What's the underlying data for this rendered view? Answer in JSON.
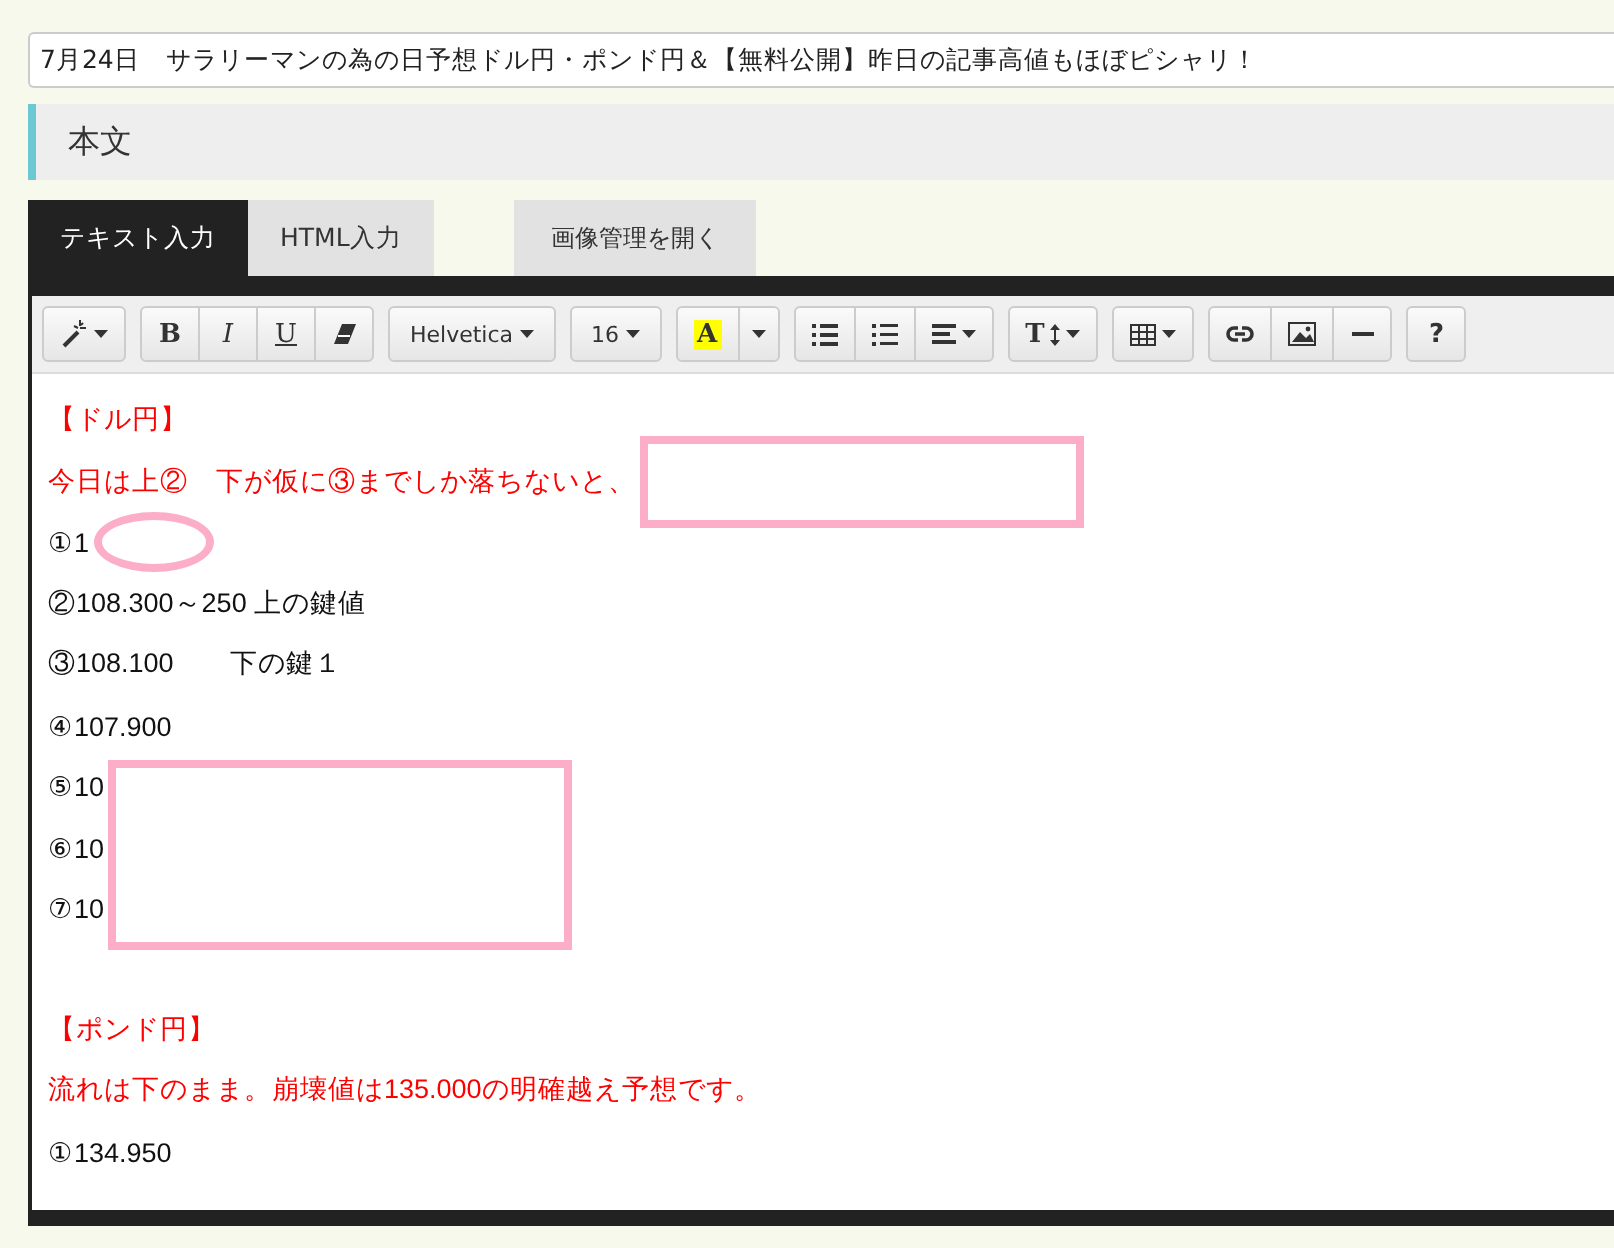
{
  "title_field": {
    "value": "7月24日　サラリーマンの為の日予想ドル円・ポンド円＆【無料公開】昨日の記事高値もほぼピシャリ！"
  },
  "section": {
    "title": "本文"
  },
  "tabs": [
    {
      "label": "テキスト入力",
      "selected": true
    },
    {
      "label": "HTML入力",
      "selected": false
    }
  ],
  "image_button": {
    "label": "画像管理を開く"
  },
  "toolbar": [
    [
      {
        "kind": "magic"
      }
    ],
    [
      {
        "kind": "bold",
        "label": "B"
      },
      {
        "kind": "italic",
        "label": "I"
      },
      {
        "kind": "underline",
        "label": "U"
      },
      {
        "kind": "eraser"
      }
    ],
    [
      {
        "kind": "dropdown",
        "label": "Helvetica"
      }
    ],
    [
      {
        "kind": "dropdown",
        "label": "16"
      }
    ],
    [
      {
        "kind": "color",
        "label": "A"
      },
      {
        "kind": "caret"
      }
    ],
    [
      {
        "kind": "ul"
      },
      {
        "kind": "ol"
      },
      {
        "kind": "align"
      }
    ],
    [
      {
        "kind": "textsize",
        "label": "T"
      }
    ],
    [
      {
        "kind": "table"
      }
    ],
    [
      {
        "kind": "link"
      },
      {
        "kind": "image"
      },
      {
        "kind": "hr"
      }
    ],
    [
      {
        "kind": "help",
        "label": "?"
      }
    ]
  ],
  "paragraphs": [
    {
      "lines": [
        {
          "text": "【ドル円】",
          "emphasis": true
        },
        {
          "text": "今日は上②　下が仮に③までしか落ちないと、",
          "emphasis": true,
          "overlay": {
            "kind": "frame"
          }
        },
        {
          "text": "①1",
          "emphasis": false,
          "overlay": {
            "kind": "ellipse"
          }
        },
        {
          "text": "②108.300～250  上の鍵値",
          "emphasis": false
        },
        {
          "text": "③108.100　　下の鍵１",
          "emphasis": false
        },
        {
          "text": "④107.900",
          "emphasis": false
        },
        {
          "text": "⑤10",
          "emphasis": false,
          "overlay": {
            "kind": "tall-frame"
          }
        },
        {
          "text": "⑥10",
          "emphasis": false
        },
        {
          "text": "⑦10",
          "emphasis": false
        }
      ]
    },
    {
      "lines": [
        {
          "text": "【ポンド円】",
          "emphasis": true
        },
        {
          "text": "流れは下のまま。崩壊値は135.000の明確越え予想です。",
          "emphasis": true
        },
        {
          "text": "①134.950",
          "emphasis": false
        }
      ]
    }
  ]
}
